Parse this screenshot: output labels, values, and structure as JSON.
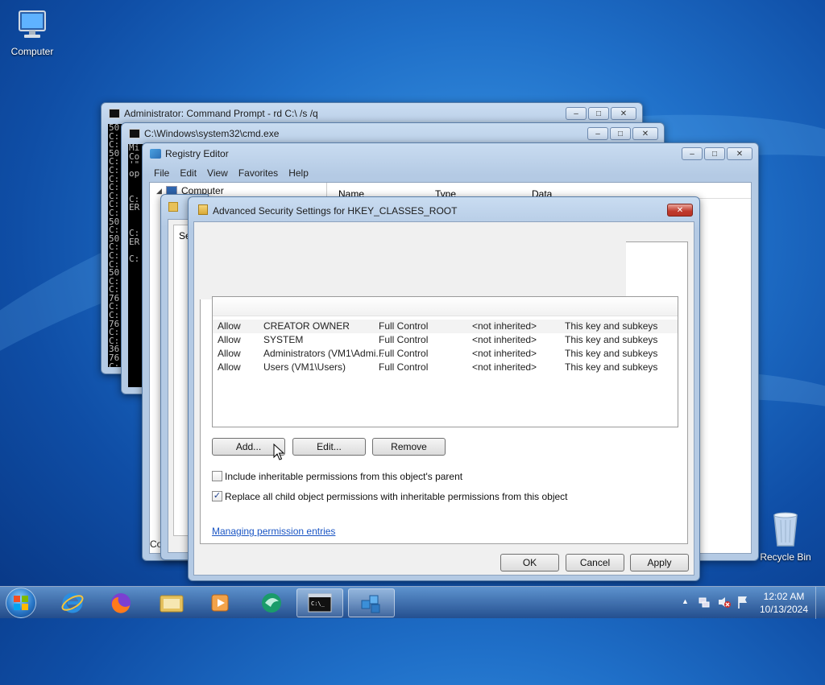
{
  "desktop": {
    "computer_label": "Computer",
    "recycle_label": "Recycle Bin"
  },
  "cmd_admin": {
    "title": "Administrator: Command Prompt - rd  C:\\ /s /q",
    "lines": [
      "50",
      "C:",
      "C:",
      "50",
      "C:",
      "C:",
      "C:",
      "C:",
      "C:",
      "C:",
      "C:",
      "50",
      "C:",
      "50",
      "C:",
      "C:",
      "C:",
      "50",
      "C:",
      "C:",
      "76",
      "C:",
      "C:",
      "76",
      "C:",
      "C:",
      "36",
      "76",
      "C:",
      "C:",
      ".?",
      "C:",
      ".?",
      "C:",
      ".?",
      "C:"
    ]
  },
  "cmd2": {
    "title": "C:\\Windows\\system32\\cmd.exe",
    "lines": [
      "Mi",
      "Co",
      "'\"",
      "op",
      "",
      "",
      "C:",
      "ER",
      "",
      "",
      "C:",
      "ER",
      "",
      "C:"
    ]
  },
  "regedit": {
    "title": "Registry Editor",
    "menu": [
      "File",
      "Edit",
      "View",
      "Favorites",
      "Help"
    ],
    "tree_root": "Computer",
    "columns": [
      "Name",
      "Type",
      "Data"
    ],
    "partial_left_s": "Se",
    "partial_left_c": "Co"
  },
  "dialog": {
    "title": "Advanced Security Settings for HKEY_CLASSES_ROOT",
    "entries": [
      {
        "type": "Allow",
        "principal": "CREATOR OWNER",
        "access": "Full Control",
        "inherited": "<not inherited>",
        "applies": "This key and subkeys"
      },
      {
        "type": "Allow",
        "principal": "SYSTEM",
        "access": "Full Control",
        "inherited": "<not inherited>",
        "applies": "This key and subkeys"
      },
      {
        "type": "Allow",
        "principal": "Administrators (VM1\\Admi...",
        "access": "Full Control",
        "inherited": "<not inherited>",
        "applies": "This key and subkeys"
      },
      {
        "type": "Allow",
        "principal": "Users (VM1\\Users)",
        "access": "Full Control",
        "inherited": "<not inherited>",
        "applies": "This key and subkeys"
      }
    ],
    "add_label": "Add...",
    "edit_label": "Edit...",
    "remove_label": "Remove",
    "include_inheritable": "Include inheritable permissions from this object's parent",
    "replace_child": "Replace all child object permissions with inheritable permissions from this object",
    "include_checked": false,
    "replace_checked": true,
    "link": "Managing permission entries",
    "ok_label": "OK",
    "cancel_label": "Cancel",
    "apply_label": "Apply"
  },
  "taskbar": {
    "time": "12:02 AM",
    "date": "10/13/2024"
  }
}
